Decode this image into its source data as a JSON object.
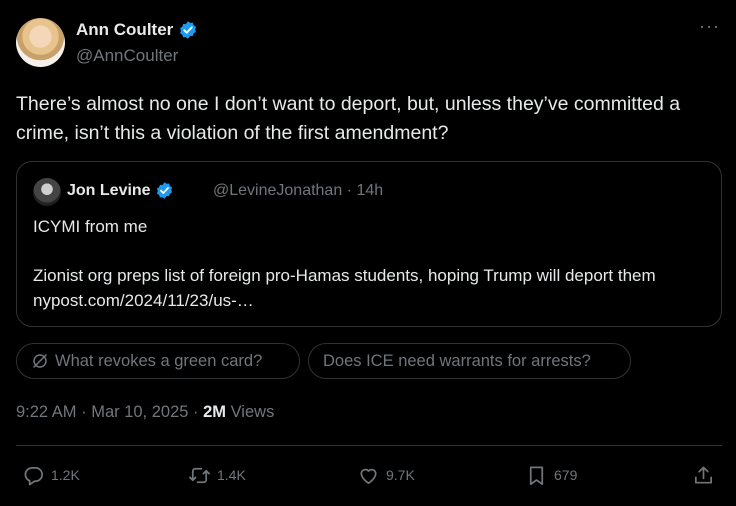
{
  "tweet": {
    "author_name": "Ann Coulter",
    "author_handle": "@AnnCoulter",
    "more_label": "···",
    "text": "There’s almost no one I don’t want to deport, but, unless they’ve committed a crime, isn’t this a violation of the first amendment?"
  },
  "quote": {
    "author_name": "Jon Levine",
    "author_handle_time": "@LevineJonathan · 14h",
    "line1": "ICYMI from me",
    "line2": "Zionist org preps list of foreign pro-Hamas students, hoping Trump will deport them nypost.com/2024/11/23/us-…"
  },
  "suggestions": [
    {
      "label": "What revokes a green card?"
    },
    {
      "label": "Does ICE need warrants for arrests?"
    }
  ],
  "meta": {
    "timestamp": "9:22 AM · Mar 10, 2025 · ",
    "views_count": "2M",
    "views_label": " Views"
  },
  "actions": {
    "replies": "1.2K",
    "reposts": "1.4K",
    "likes": "9.7K",
    "bookmarks": "679"
  },
  "colors": {
    "background": "#000000",
    "text": "#e7e9ea",
    "muted": "#71767b",
    "verified": "#1d9bf0",
    "border": "#2f3336"
  },
  "icons": [
    "verified-badge-icon",
    "more-icon",
    "grok-icon",
    "reply-icon",
    "repost-icon",
    "like-icon",
    "bookmark-icon",
    "share-icon"
  ]
}
